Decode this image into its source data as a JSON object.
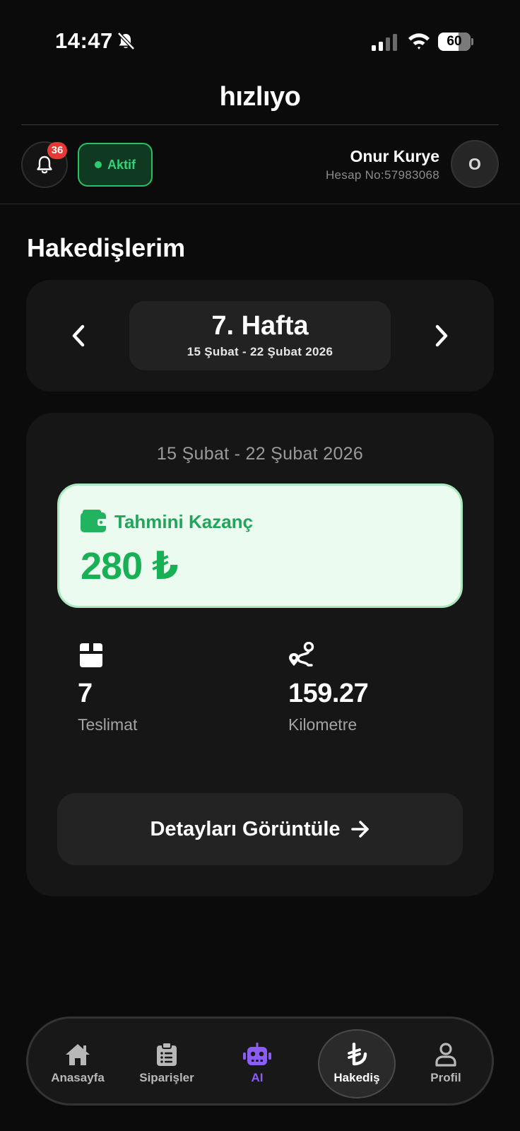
{
  "status_bar": {
    "time": "14:47",
    "battery": "60",
    "icons": [
      "bell-slash-icon",
      "signal-icon",
      "wifi-icon",
      "battery-icon"
    ]
  },
  "header": {
    "brand": "hızlıyo",
    "notification_count": "36",
    "status_label": "Aktif",
    "user_name": "Onur Kurye",
    "account_no": "Hesap No:57983068",
    "avatar_initial": "O"
  },
  "page": {
    "title": "Hakedişlerim"
  },
  "week_selector": {
    "title": "7. Hafta",
    "range": "15 Şubat - 22 Şubat 2026"
  },
  "earnings": {
    "range": "15 Şubat - 22 Şubat 2026",
    "label": "Tahmini Kazanç",
    "value": "280 ₺"
  },
  "stats": {
    "deliveries_value": "7",
    "deliveries_label": "Teslimat",
    "km_value": "159.27",
    "km_label": "Kilometre"
  },
  "details_button": {
    "label": "Detayları Görüntüle"
  },
  "bottom_nav": {
    "home": "Anasayfa",
    "orders": "Siparişler",
    "ai": "AI",
    "payout": "Hakediş",
    "profile": "Profil",
    "active": "Hakediş"
  },
  "colors": {
    "background": "#0b0b0b",
    "card": "#161616",
    "accent_green": "#18b055",
    "earn_box_bg": "#ecfbef",
    "ai_purple": "#8b5cf6",
    "badge_red": "#e53935"
  }
}
